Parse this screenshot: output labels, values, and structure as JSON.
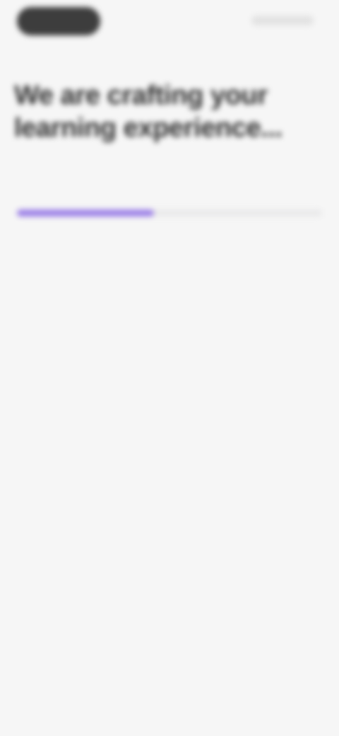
{
  "header": {
    "left_button": "",
    "right_label": ""
  },
  "main": {
    "title": "We are crafting your learning experience..."
  },
  "progress": {
    "label": "",
    "percent_text": "",
    "value": 0.45,
    "color": "#9c80e7"
  },
  "center": {
    "title": "",
    "subtitle": ""
  }
}
